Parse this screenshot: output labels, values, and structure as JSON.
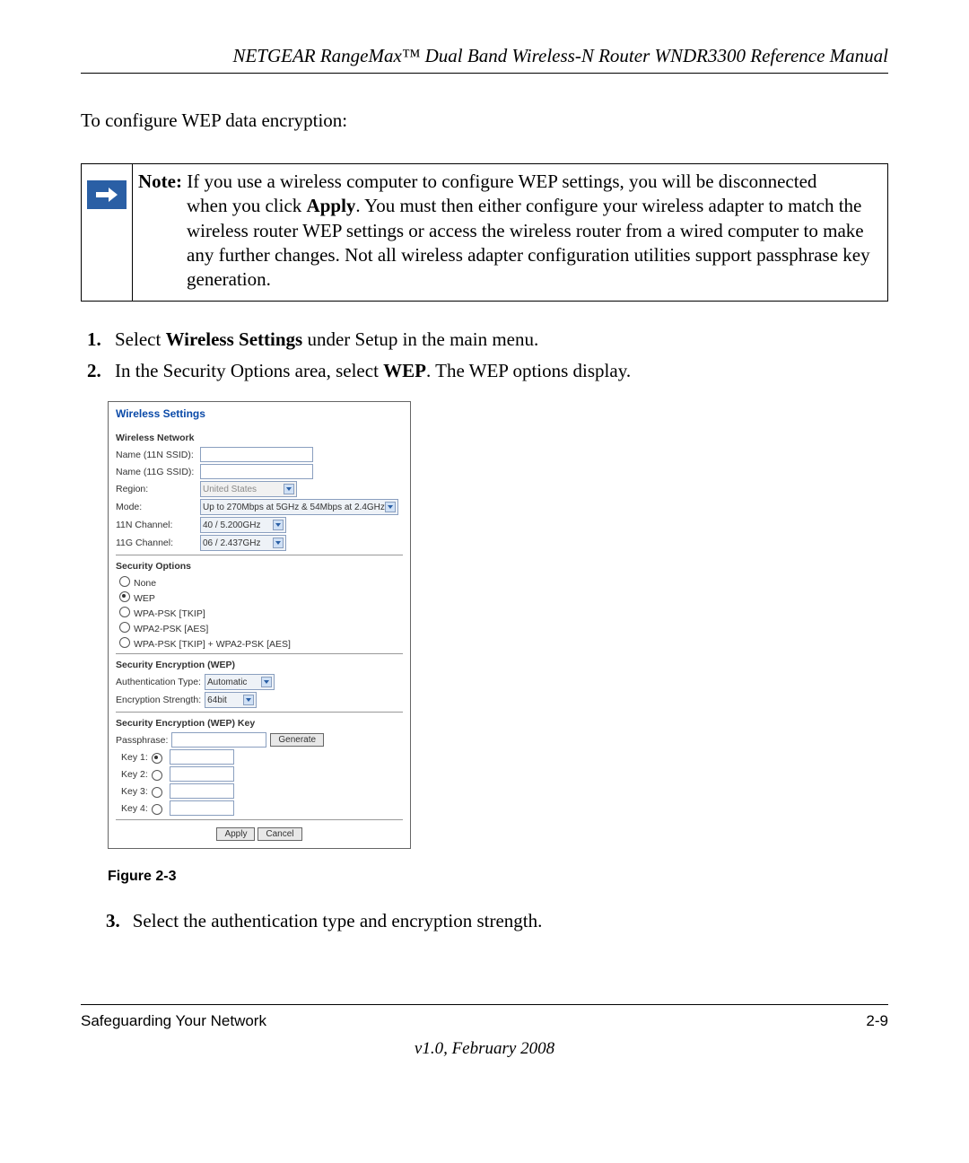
{
  "header": {
    "title": "NETGEAR RangeMax™ Dual Band Wireless-N Router WNDR3300 Reference Manual"
  },
  "intro": "To configure WEP data encryption:",
  "note": {
    "label": "Note:",
    "first_line_rest": " If you use a wireless computer to configure WEP settings, you will be disconnected",
    "rest": "when you click Apply. You must then either configure your wireless adapter to match the wireless router WEP settings or access the wireless router from a wired computer to make any further changes. Not all wireless adapter configuration utilities support passphrase key generation.",
    "apply_word": "Apply",
    "rest_prefix": "when you click ",
    "rest_suffix": ". You must then either configure your wireless adapter to match the wireless router WEP settings or access the wireless router from a wired computer to make any further changes. Not all wireless adapter configuration utilities support passphrase key generation."
  },
  "steps": {
    "s1_a": "Select ",
    "s1_bold": "Wireless Settings",
    "s1_b": " under Setup in the main menu.",
    "s2_a": "In the Security Options area, select ",
    "s2_bold": "WEP",
    "s2_b": ". The WEP options display.",
    "s3": "Select the authentication type and encryption strength."
  },
  "panel": {
    "title": "Wireless Settings",
    "network": {
      "heading": "Wireless Network",
      "name11n_label": "Name (11N SSID):",
      "name11g_label": "Name (11G SSID):",
      "region_label": "Region:",
      "region_value": "United States",
      "mode_label": "Mode:",
      "mode_value": "Up to 270Mbps at 5GHz & 54Mbps at 2.4GHz",
      "ch11n_label": "11N Channel:",
      "ch11n_value": "40 / 5.200GHz",
      "ch11g_label": "11G Channel:",
      "ch11g_value": "06 / 2.437GHz"
    },
    "security": {
      "heading": "Security Options",
      "opts": [
        "None",
        "WEP",
        "WPA-PSK [TKIP]",
        "WPA2-PSK [AES]",
        "WPA-PSK [TKIP] + WPA2-PSK [AES]"
      ],
      "selected_index": 1
    },
    "wep": {
      "heading": "Security Encryption (WEP)",
      "auth_label": "Authentication Type:",
      "auth_value": "Automatic",
      "strength_label": "Encryption Strength:",
      "strength_value": "64bit"
    },
    "wepkey": {
      "heading": "Security Encryption (WEP) Key",
      "passphrase_label": "Passphrase:",
      "generate": "Generate",
      "keys": [
        "Key 1:",
        "Key 2:",
        "Key 3:",
        "Key 4:"
      ],
      "selected_key": 0
    },
    "buttons": {
      "apply": "Apply",
      "cancel": "Cancel"
    }
  },
  "figure_caption": "Figure 2-3",
  "footer": {
    "left": "Safeguarding Your Network",
    "right": "2-9",
    "version": "v1.0, February 2008"
  }
}
